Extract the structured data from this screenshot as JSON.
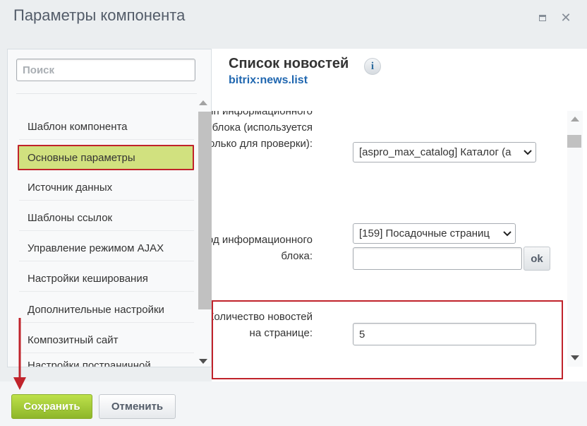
{
  "dialog": {
    "title": "Параметры компонента"
  },
  "sidebar": {
    "search_placeholder": "Поиск",
    "items": [
      {
        "label": "Шаблон компонента"
      },
      {
        "label": "Основные параметры",
        "active": true
      },
      {
        "label": "Источник данных"
      },
      {
        "label": "Шаблоны ссылок"
      },
      {
        "label": "Управление режимом AJAX"
      },
      {
        "label": "Настройки кеширования"
      },
      {
        "label": "Дополнительные настройки"
      },
      {
        "label": "Композитный сайт"
      },
      {
        "label": "Настройки постраничной"
      }
    ]
  },
  "component": {
    "title": "Список новостей",
    "code": "bitrix:news.list",
    "info_icon": "info-icon"
  },
  "form": {
    "iblock_type": {
      "label": "Тип информационного блока (используется только для проверки):",
      "value": "[aspro_max_catalog] Каталог (а"
    },
    "iblock_code": {
      "label": "Код информационного блока:",
      "value": "[159] Посадочные страниц",
      "input_value": "",
      "ok_label": "ok"
    },
    "news_count": {
      "label": "Количество новостей на странице:",
      "value": "5"
    }
  },
  "footer": {
    "save_label": "Сохранить",
    "cancel_label": "Отменить"
  },
  "colors": {
    "accent_highlight": "#c0232b",
    "active_item_bg": "#d1e17f",
    "save_button": "#9cc437",
    "link_blue": "#2067b0"
  }
}
